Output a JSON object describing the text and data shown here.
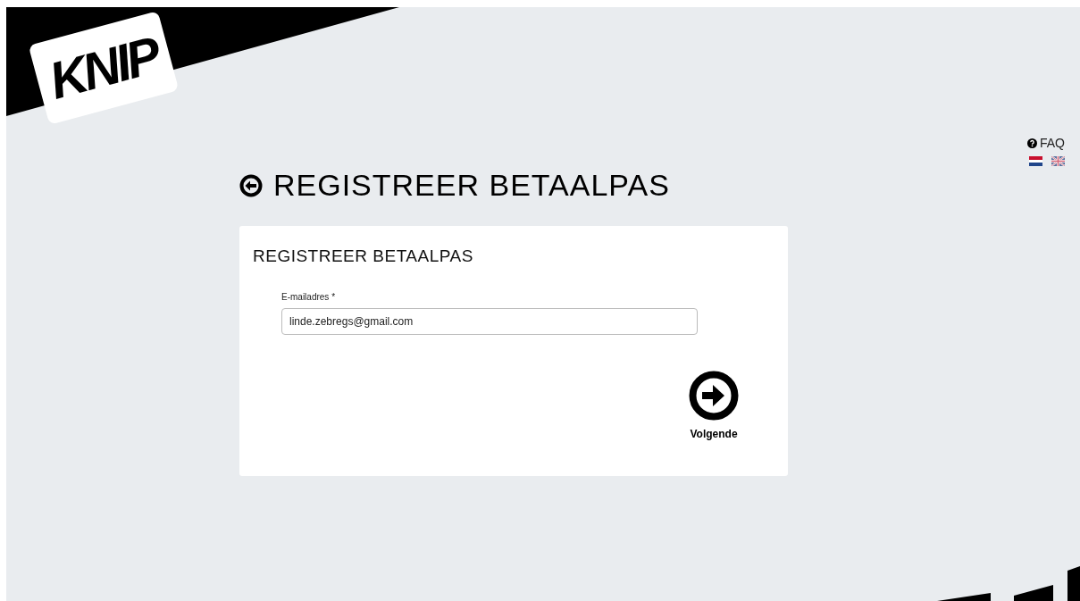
{
  "logo": {
    "text": "KNIP"
  },
  "top_links": {
    "faq": "FAQ",
    "languages": [
      {
        "kind": "nl",
        "selected": true
      },
      {
        "kind": "en",
        "selected": false
      }
    ]
  },
  "page_title": "REGISTREER BETAALPAS",
  "card": {
    "title": "REGISTREER BETAALPAS",
    "field": {
      "label": "E-mailadres *",
      "value": "linde.zebregs@gmail.com"
    },
    "next_button": "Volgende"
  }
}
